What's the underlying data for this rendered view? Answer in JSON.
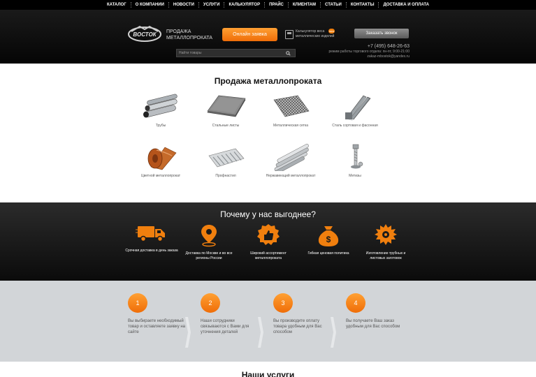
{
  "nav": {
    "items": [
      "КАТАЛОГ",
      "О КОМПАНИИ",
      "НОВОСТИ",
      "УСЛУГИ",
      "КАЛЬКУЛЯТОР",
      "ПРАЙС",
      "КЛИЕНТАМ",
      "СТАТЬИ",
      "КОНТАКТЫ",
      "ДОСТАВКА И ОПЛАТА"
    ]
  },
  "header": {
    "logo_text": "ВОСТОК",
    "brand_line1": "ПРОДАЖА",
    "brand_line2": "МЕТАЛЛОПРОКАТА",
    "cta_label": "Онлайн заявка",
    "calc_line1": "Калькулятор веса",
    "calc_line2": "металлических изделий",
    "calc_badge": "new",
    "callback_label": "Заказать звонок",
    "search_placeholder": "Найти товары",
    "phone": "+7 (495) 648-26-63",
    "hours": "режим работы торгового отдела: пн-пт, 9:00-21:00",
    "email": "zakaz-mbostok@yandex.ru"
  },
  "catalog": {
    "title": "Продажа металлопроката",
    "items": [
      {
        "label": "Трубы",
        "icon": "pipes-icon"
      },
      {
        "label": "Стальные листы",
        "icon": "steel-sheets-icon"
      },
      {
        "label": "Металлическая сетка",
        "icon": "metal-mesh-icon"
      },
      {
        "label": "Сталь сортовая и фасонная",
        "icon": "steel-beam-icon"
      },
      {
        "label": "Цветной металлопрокат",
        "icon": "copper-roll-icon"
      },
      {
        "label": "Профнастил",
        "icon": "corrugated-sheet-icon"
      },
      {
        "label": "Нержавеющий металлопрокат",
        "icon": "stainless-pipes-icon"
      },
      {
        "label": "Метизы",
        "icon": "bolts-icon"
      }
    ]
  },
  "why": {
    "title": "Почему у нас выгоднее?",
    "items": [
      {
        "label": "Срочная доставка в день заказа",
        "icon": "truck-icon"
      },
      {
        "label": "Доставка по Москве и во все регионы России",
        "icon": "map-pin-icon"
      },
      {
        "label": "Широкий ассортимент металлопроката",
        "icon": "thumbs-up-icon"
      },
      {
        "label": "Гибкая ценовая политика",
        "icon": "money-bag-icon"
      },
      {
        "label": "Изготовление трубных и листовых заготовок",
        "icon": "saw-blade-icon"
      }
    ]
  },
  "steps": {
    "items": [
      {
        "num": "1",
        "text": "Вы выбираете необходимый товар и оставляете заявку на сайте"
      },
      {
        "num": "2",
        "text": "Наши сотрудники связываются с Вами для уточнения деталей"
      },
      {
        "num": "3",
        "text": "Вы производите оплату товара удобным для Вас способом"
      },
      {
        "num": "4",
        "text": "Вы получаете Ваш заказ удобным для Вас способом"
      }
    ]
  },
  "services": {
    "title": "Наши услуги"
  },
  "colors": {
    "accent": "#f07f0e",
    "dark": "#0b0b0b",
    "steps_bg": "#d2d5d8"
  }
}
